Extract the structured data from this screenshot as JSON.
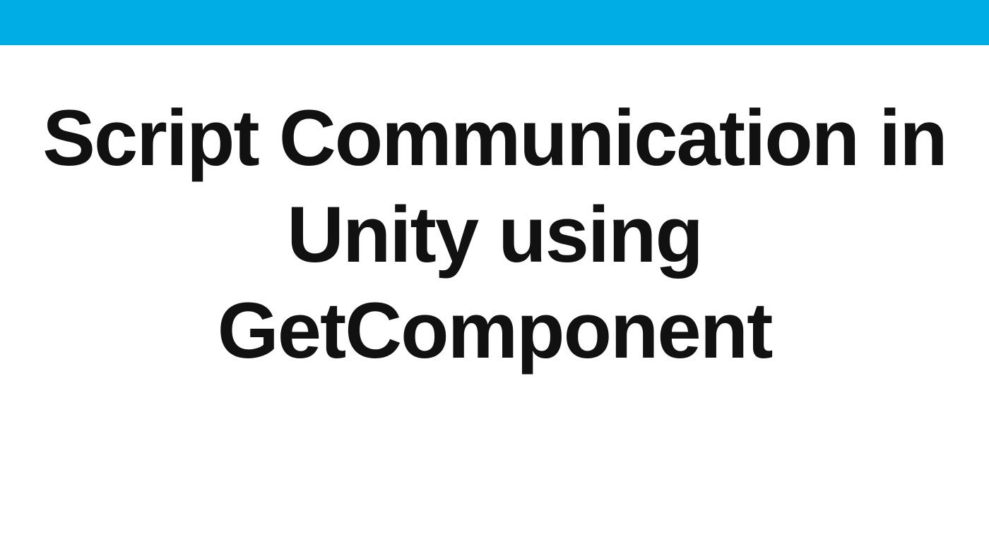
{
  "accent_color": "#00aee6",
  "slide": {
    "title": "Script Communication in Unity using GetComponent"
  }
}
